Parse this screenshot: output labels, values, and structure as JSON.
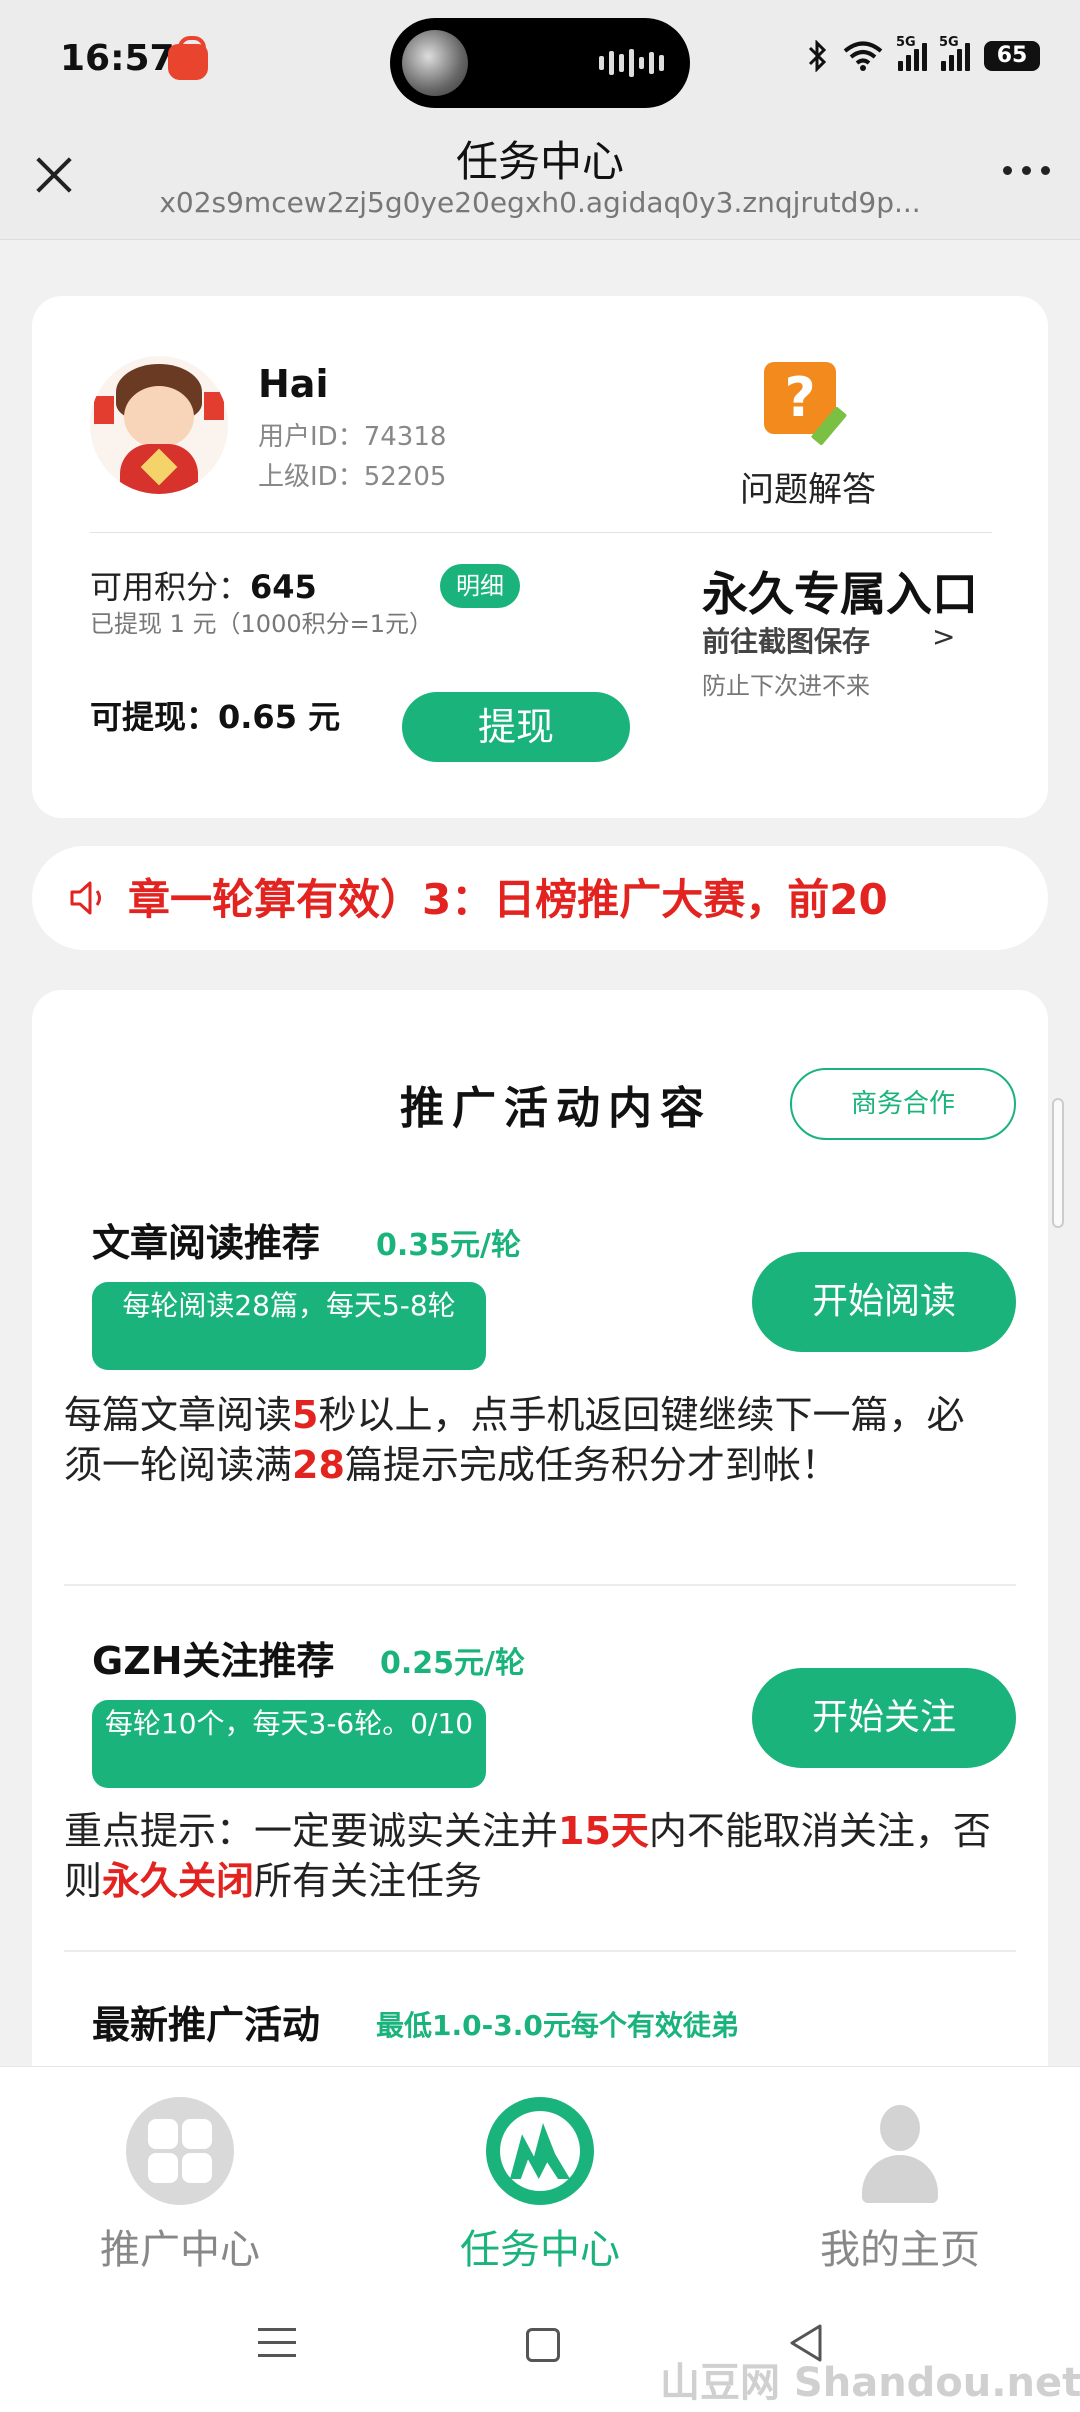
{
  "status_bar": {
    "time": "16:57",
    "signal1_label": "5G",
    "signal2_label": "5G",
    "battery": "65"
  },
  "title_bar": {
    "title": "任务中心",
    "url": "x02s9mcew2zj5g0ye20egxh0.agidaq0y3.znqjrutd9p..."
  },
  "user_card": {
    "name": "Hai",
    "user_id": "用户ID：74318",
    "parent_id": "上级ID：52205",
    "qa_label": "问题解答",
    "qa_icon_glyph": "?",
    "points_label": "可用积分：",
    "points_value": "645",
    "detail_badge": "明细",
    "withdrawn_info": "已提现 1 元（1000积分=1元）",
    "withdrawable": "可提现：0.65 元",
    "withdraw_button": "提现",
    "entry_title": "永久专属入口",
    "entry_sub": "前往截图保存",
    "entry_arrow": ">",
    "entry_note": "防止下次进不来"
  },
  "marquee": {
    "text": "章一轮算有效）3：日榜推广大赛，前20"
  },
  "activities": {
    "title": "推广活动内容",
    "business_button": "商务合作",
    "tasks": [
      {
        "name": "文章阅读推荐",
        "price": "0.35元/轮",
        "tag": "每轮阅读28篇，每天5-8轮",
        "button": "开始阅读",
        "desc_parts": [
          "每篇文章阅读",
          "5",
          "秒以上，点手机返回键继续下一篇，必须一轮阅读满",
          "28",
          "篇提示完成任务积分才到帐！"
        ]
      },
      {
        "name": "GZH关注推荐",
        "price": "0.25元/轮",
        "tag": "每轮10个，每天3-6轮。0/10",
        "button": "开始关注",
        "desc_parts": [
          "重点提示：一定要诚实关注并",
          "15天",
          "内不能取消关注，否则",
          "永久关闭",
          "所有关注任务"
        ]
      },
      {
        "name": "最新推广活动",
        "price": "最低1.0-3.0元每个有效徒弟"
      }
    ]
  },
  "bottom_nav": {
    "items": [
      {
        "label": "推广中心",
        "icon": "grid-icon",
        "active": false
      },
      {
        "label": "任务中心",
        "icon": "task-mountain-icon",
        "active": true
      },
      {
        "label": "我的主页",
        "icon": "profile-icon",
        "active": false
      }
    ]
  },
  "watermark": "山豆网 Shandou.net",
  "colors": {
    "accent": "#1ab37b",
    "highlight": "#e3231f",
    "inactive": "#888888"
  }
}
